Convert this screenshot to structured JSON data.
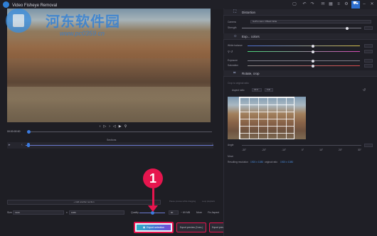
{
  "window": {
    "subtitle": "…",
    "title": "Video Fisheye Removal"
  },
  "watermark": {
    "title": "河东软件园",
    "url": "www.pc0359.cn"
  },
  "playback": {
    "timecode": "00:00:00:00",
    "controls": [
      "‹",
      "▷",
      "›",
      "◁",
      "▶",
      "⚲"
    ]
  },
  "timeline": {
    "label": "Sections"
  },
  "bottom": {
    "add_section": "+ Add another section",
    "check_preview": "Pause preview while dragging",
    "check_loop": "Loop playback",
    "size_label": "Size",
    "width": "1920",
    "x_label": "x",
    "height": "1080",
    "quality_label": "Quality",
    "quality_value": "80",
    "size_estimate": "~ 69 MB",
    "more_label": "More",
    "fix_aspect": "Fix Aspect"
  },
  "annotation": {
    "number": "1"
  },
  "export": {
    "selection": "Export selection",
    "preview_3": "Export preview (3 sec.)",
    "preview_10": "Export preview (10 sec.)"
  },
  "panel": {
    "distortion": {
      "title": "Distortion",
      "camera_label": "Camera",
      "camera_value": "GoPro Hero 3 Black Wide",
      "strength_label": "Strength",
      "strength_fraction": 0.88
    },
    "exposure": {
      "title": "Exp... colors",
      "rows": [
        {
          "label": "White balance",
          "fraction": 0.58
        },
        {
          "label": "",
          "fraction": 0.58
        },
        {
          "label": "Exposure",
          "fraction": 0.58
        },
        {
          "label": "Saturation",
          "fraction": 0.58
        }
      ]
    },
    "rotate": {
      "title": "Rotate, crop",
      "crop_label": "Crop to original ratio",
      "aspect_label": "Aspect ratio",
      "aspect_value": "16:9",
      "crop_value": "Full",
      "angle_label": "Angle",
      "axis_ticks": [
        "-30°",
        "-20°",
        "-10°",
        "0°",
        "10°",
        "20°",
        "30°"
      ],
      "move_label": "Move",
      "resolution_label": "Resulting resolution",
      "resolution_value": "1920 x 1080",
      "original_label": "original ratio",
      "original_value": "1920 x 1080"
    }
  },
  "colors": {
    "accent": "#2f7fd6",
    "annotation": "#e6154e",
    "background": "#1e1e24"
  }
}
